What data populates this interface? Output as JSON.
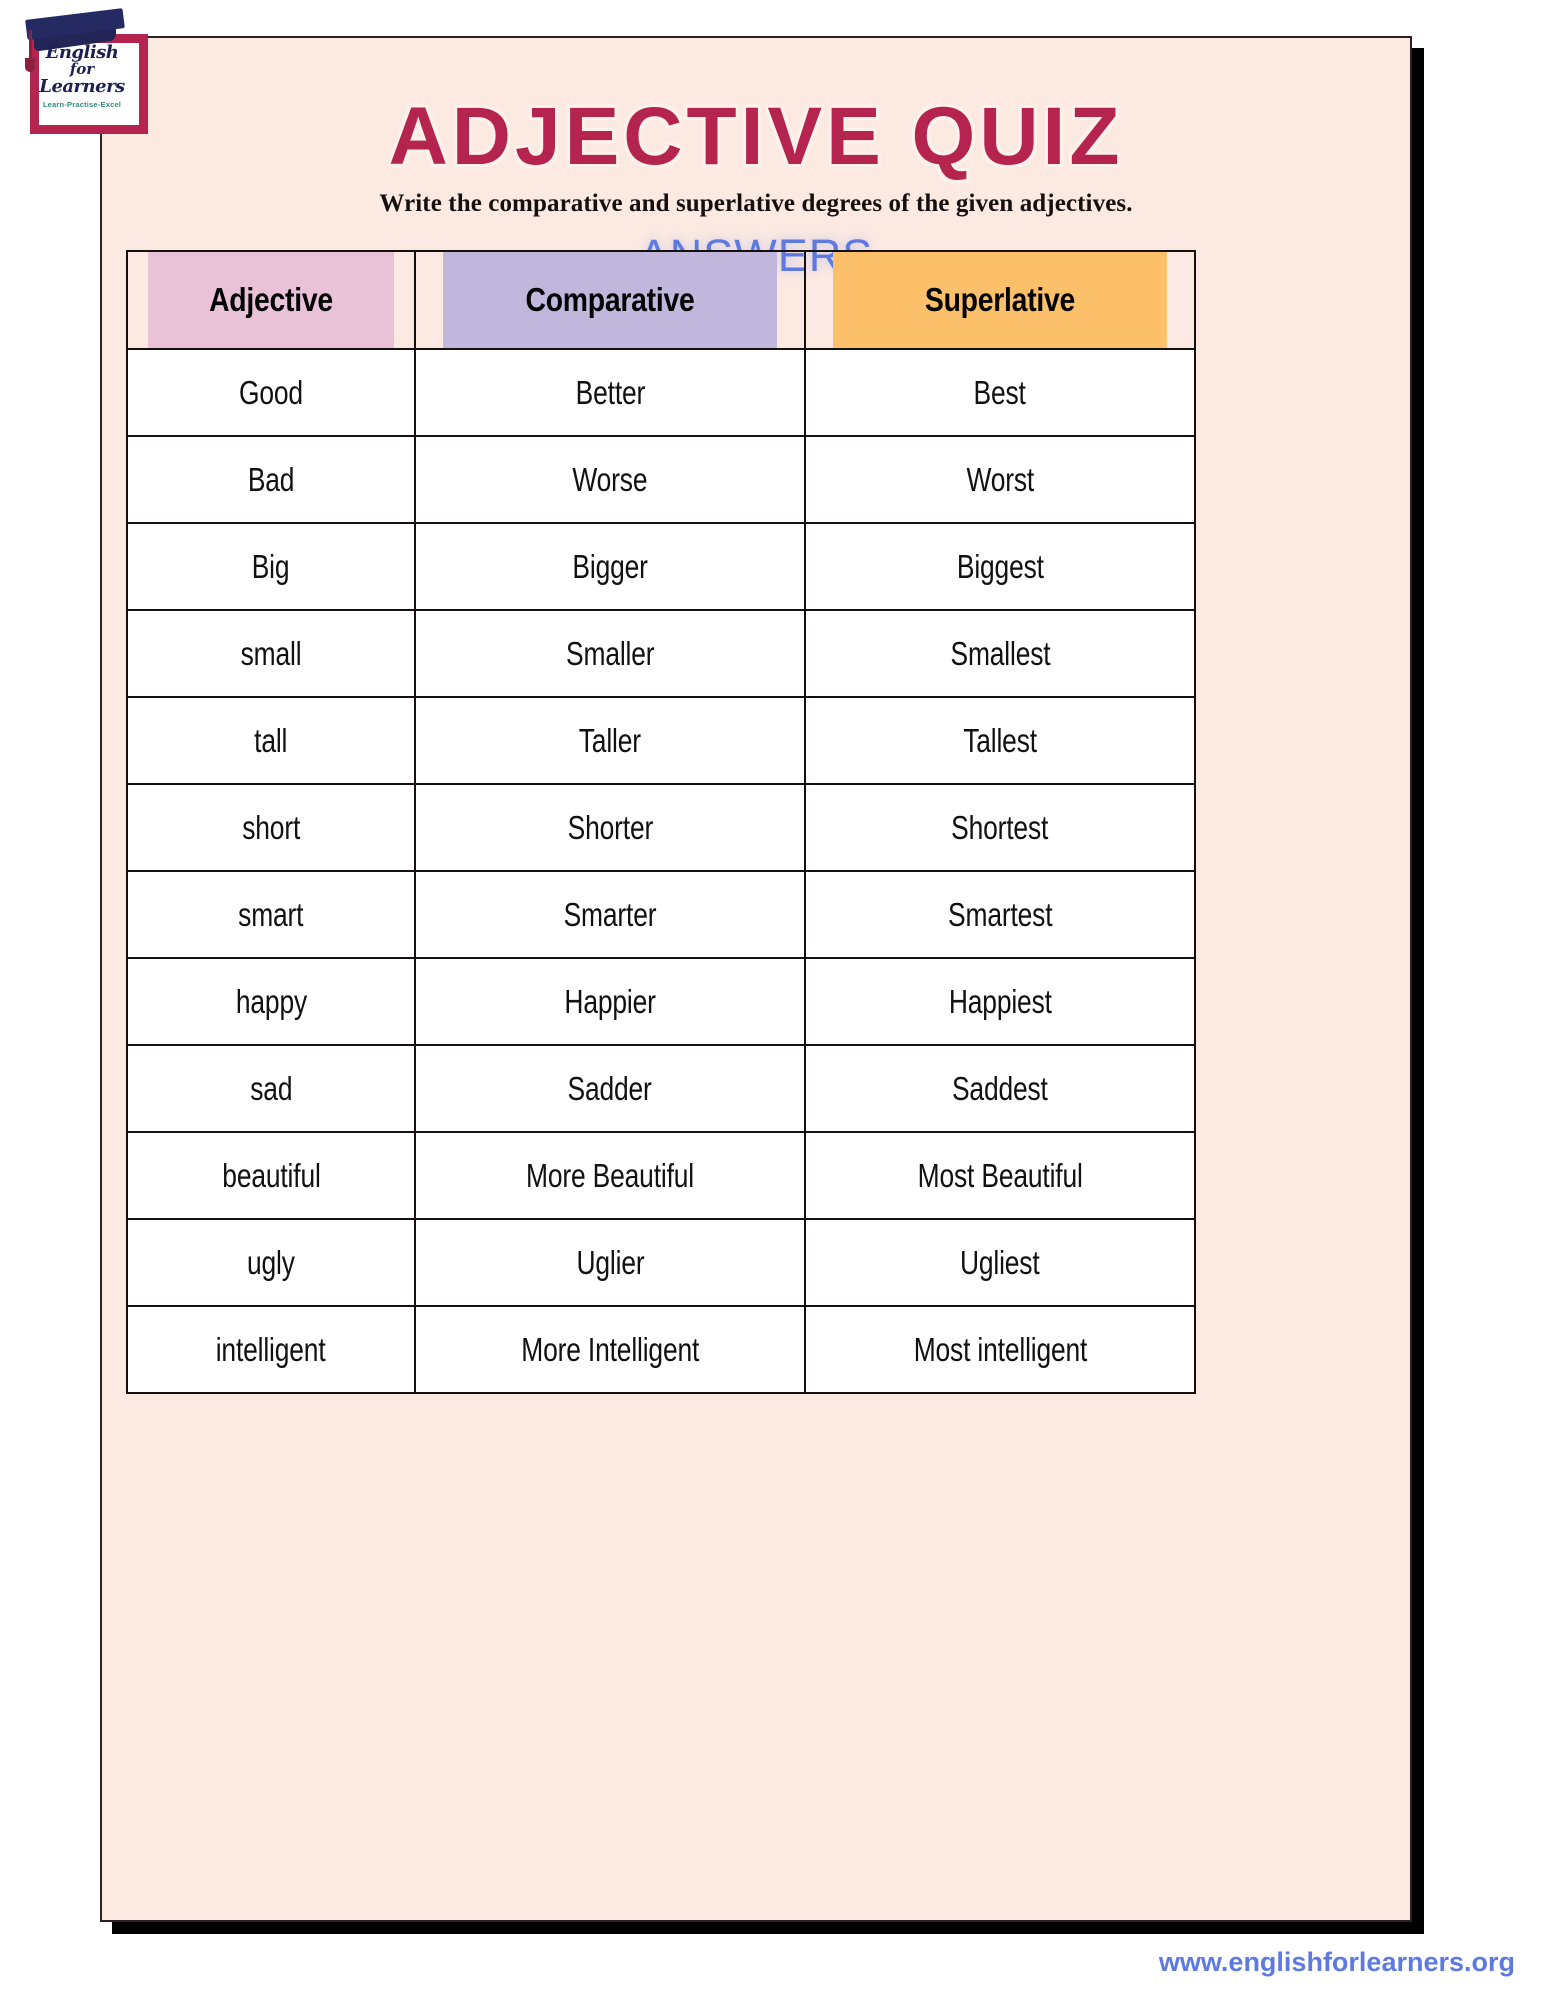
{
  "logo": {
    "line1": "English",
    "line2": "for",
    "line3": "Learners",
    "tagline": "Learn-Practise-Excel",
    "cap_icon": "graduation-cap-icon"
  },
  "header": {
    "title": "ADJECTIVE QUIZ",
    "subtitle": "Write the comparative and superlative degrees of the given adjectives.",
    "answers_label": "ANSWERS"
  },
  "table": {
    "columns": [
      "Adjective",
      "Comparative",
      "Superlative"
    ],
    "header_colors": [
      "#e9c2d8",
      "#c1b7dd",
      "#fbc069"
    ],
    "rows": [
      {
        "adjective": "Good",
        "comparative": "Better",
        "superlative": "Best"
      },
      {
        "adjective": "Bad",
        "comparative": "Worse",
        "superlative": "Worst"
      },
      {
        "adjective": "Big",
        "comparative": "Bigger",
        "superlative": "Biggest"
      },
      {
        "adjective": "small",
        "comparative": "Smaller",
        "superlative": "Smallest"
      },
      {
        "adjective": "tall",
        "comparative": "Taller",
        "superlative": "Tallest"
      },
      {
        "adjective": "short",
        "comparative": "Shorter",
        "superlative": "Shortest"
      },
      {
        "adjective": "smart",
        "comparative": "Smarter",
        "superlative": "Smartest"
      },
      {
        "adjective": "happy",
        "comparative": "Happier",
        "superlative": "Happiest"
      },
      {
        "adjective": "sad",
        "comparative": "Sadder",
        "superlative": "Saddest"
      },
      {
        "adjective": "beautiful",
        "comparative": "More Beautiful",
        "superlative": "Most Beautiful"
      },
      {
        "adjective": "ugly",
        "comparative": "Uglier",
        "superlative": "Ugliest"
      },
      {
        "adjective": "intelligent",
        "comparative": "More Intelligent",
        "superlative": "Most intelligent"
      }
    ]
  },
  "footer": {
    "url": "www.englishforlearners.org"
  },
  "colors": {
    "page_background": "#fce9e2",
    "title": "#b5234f",
    "accent_blue": "#5e7ae0",
    "logo_frame": "#b5234f",
    "logo_navy": "#1d2050",
    "logo_teal": "#2f8f78"
  }
}
